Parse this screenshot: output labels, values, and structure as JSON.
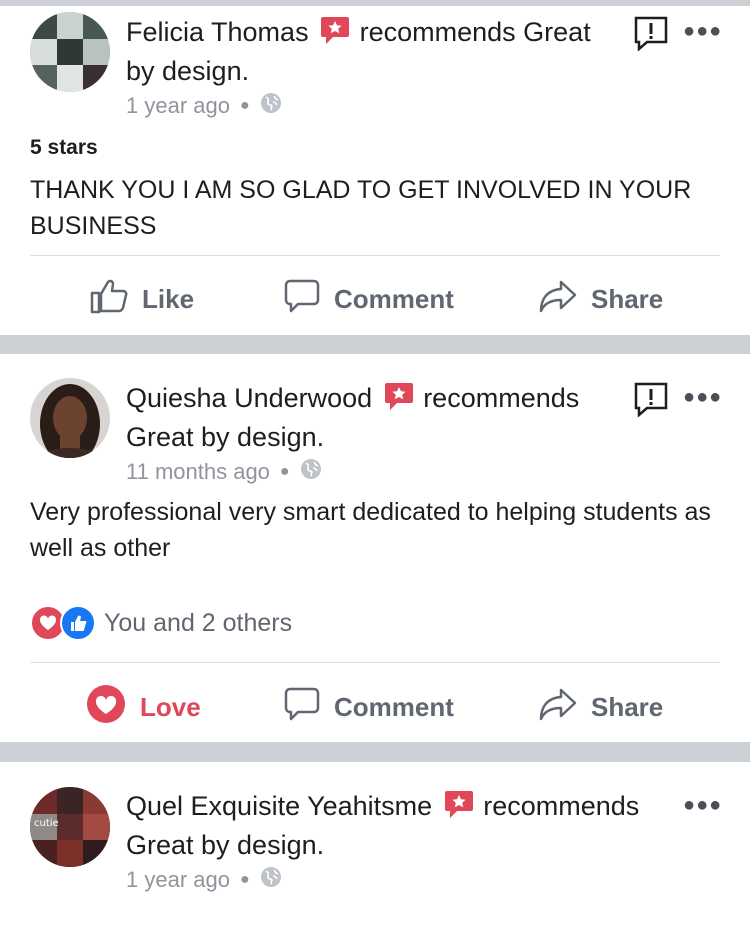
{
  "posts": [
    {
      "author": "Felicia Thomas",
      "action_text": "recommends Great by design.",
      "time": "1 year ago",
      "rating": "5 stars",
      "text": "THANK YOU I AM SO GLAD TO GET INVOLVED IN YOUR BUSINESS",
      "actions": {
        "like": "Like",
        "comment": "Comment",
        "share": "Share"
      }
    },
    {
      "author": "Quiesha Underwood",
      "action_text": "recommends Great by design.",
      "time": "11 months ago",
      "text": "Very professional very smart dedicated to helping students as well as other",
      "reactions": "You and 2 others",
      "actions": {
        "love": "Love",
        "comment": "Comment",
        "share": "Share"
      }
    },
    {
      "author": "Quel Exquisite Yeahitsme",
      "action_text": "recommends Great by design.",
      "time": "1 year ago",
      "avatar_label": "cutie"
    }
  ],
  "colors": {
    "accent_love": "#e0485a",
    "badge": "#e0485a",
    "like_blue": "#1877f2",
    "separator": "#cdd0d5"
  },
  "icons": [
    "recommend-badge-icon",
    "globe-icon",
    "report-icon",
    "more-icon",
    "like-icon",
    "comment-icon",
    "share-icon",
    "love-icon"
  ]
}
